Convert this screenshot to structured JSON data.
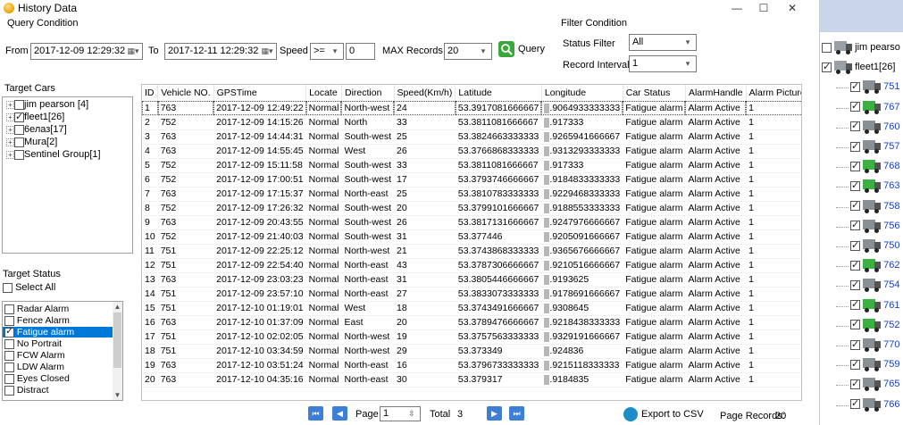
{
  "window": {
    "title": "History Data",
    "minimize": "—",
    "maximize": "☐",
    "close": "✕"
  },
  "query": {
    "group_title": "Query Condition",
    "from_label": "From",
    "from_value": "2017-12-09 12:29:32",
    "to_label": "To",
    "to_value": "2017-12-11 12:29:32",
    "speed_label": "Speed",
    "speed_op": ">=",
    "speed_value": "0",
    "max_records_label": "MAX Records",
    "max_records_value": "20",
    "query_button": "Query"
  },
  "filter": {
    "group_title": "Filter Condition",
    "status_filter_label": "Status Filter",
    "status_filter_value": "All",
    "record_interval_label": "Record Interval",
    "record_interval_value": "1"
  },
  "target_cars": {
    "title": "Target Cars",
    "items": [
      {
        "label": "jim pearson [4]",
        "checked": false
      },
      {
        "label": "fleet1[26]",
        "checked": true
      },
      {
        "label": "6елаз[17]",
        "checked": false
      },
      {
        "label": "Mura[2]",
        "checked": false
      },
      {
        "label": "Sentinel Group[1]",
        "checked": false
      }
    ]
  },
  "target_status": {
    "title": "Target Status",
    "select_all": "Select All",
    "items": [
      {
        "label": "Radar Alarm",
        "checked": false,
        "selected": false
      },
      {
        "label": "Fence Alarm",
        "checked": false,
        "selected": false
      },
      {
        "label": "Fatigue alarm",
        "checked": true,
        "selected": true
      },
      {
        "label": "No Portrait",
        "checked": false,
        "selected": false
      },
      {
        "label": "FCW Alarm",
        "checked": false,
        "selected": false
      },
      {
        "label": "LDW Alarm",
        "checked": false,
        "selected": false
      },
      {
        "label": "Eyes Closed",
        "checked": false,
        "selected": false
      },
      {
        "label": "Distract",
        "checked": false,
        "selected": false
      }
    ]
  },
  "table": {
    "columns": [
      "ID",
      "Vehicle NO.",
      "GPSTime",
      "Locate",
      "Direction",
      "Speed(Km/h)",
      "Latitude",
      "Longitude",
      "Car Status",
      "AlarmHandle",
      "Alarm Picture"
    ],
    "rows": [
      [
        "1",
        "763",
        "2017-12-09 12:49:22",
        "Normal",
        "North-west",
        "24",
        "53.3917081666667",
        ".9064933333333",
        "Fatigue alarm",
        "Alarm Active",
        "1"
      ],
      [
        "2",
        "752",
        "2017-12-09 14:15:26",
        "Normal",
        "North",
        "33",
        "53.3811081666667",
        ".917333",
        "Fatigue alarm",
        "Alarm Active",
        "1"
      ],
      [
        "3",
        "763",
        "2017-12-09 14:44:31",
        "Normal",
        "South-west",
        "25",
        "53.3824663333333",
        ".9265941666667",
        "Fatigue alarm",
        "Alarm Active",
        "1"
      ],
      [
        "4",
        "763",
        "2017-12-09 14:55:45",
        "Normal",
        "West",
        "26",
        "53.3766868333333",
        ".9313293333333",
        "Fatigue alarm",
        "Alarm Active",
        "1"
      ],
      [
        "5",
        "752",
        "2017-12-09 15:11:58",
        "Normal",
        "South-west",
        "33",
        "53.3811081666667",
        ".917333",
        "Fatigue alarm",
        "Alarm Active",
        "1"
      ],
      [
        "6",
        "752",
        "2017-12-09 17:00:51",
        "Normal",
        "South-west",
        "17",
        "53.3793746666667",
        ".9184833333333",
        "Fatigue alarm",
        "Alarm Active",
        "1"
      ],
      [
        "7",
        "763",
        "2017-12-09 17:15:37",
        "Normal",
        "North-east",
        "25",
        "53.3810783333333",
        ".9229468333333",
        "Fatigue alarm",
        "Alarm Active",
        "1"
      ],
      [
        "8",
        "752",
        "2017-12-09 17:26:32",
        "Normal",
        "South-west",
        "20",
        "53.3799101666667",
        ".9188553333333",
        "Fatigue alarm",
        "Alarm Active",
        "1"
      ],
      [
        "9",
        "763",
        "2017-12-09 20:43:55",
        "Normal",
        "South-west",
        "26",
        "53.3817131666667",
        ".9247976666667",
        "Fatigue alarm",
        "Alarm Active",
        "1"
      ],
      [
        "10",
        "752",
        "2017-12-09 21:40:03",
        "Normal",
        "South-west",
        "31",
        "53.377446",
        ".9205091666667",
        "Fatigue alarm",
        "Alarm Active",
        "1"
      ],
      [
        "11",
        "751",
        "2017-12-09 22:25:12",
        "Normal",
        "North-west",
        "21",
        "53.3743868333333",
        ".9365676666667",
        "Fatigue alarm",
        "Alarm Active",
        "1"
      ],
      [
        "12",
        "751",
        "2017-12-09 22:54:40",
        "Normal",
        "North-east",
        "43",
        "53.3787306666667",
        ".9210516666667",
        "Fatigue alarm",
        "Alarm Active",
        "1"
      ],
      [
        "13",
        "763",
        "2017-12-09 23:03:23",
        "Normal",
        "North-east",
        "31",
        "53.3805446666667",
        ".9193625",
        "Fatigue alarm",
        "Alarm Active",
        "1"
      ],
      [
        "14",
        "751",
        "2017-12-09 23:57:10",
        "Normal",
        "North-east",
        "27",
        "53.3833073333333",
        ".9178691666667",
        "Fatigue alarm",
        "Alarm Active",
        "1"
      ],
      [
        "15",
        "751",
        "2017-12-10 01:19:01",
        "Normal",
        "West",
        "18",
        "53.3743491666667",
        ".9308645",
        "Fatigue alarm",
        "Alarm Active",
        "1"
      ],
      [
        "16",
        "763",
        "2017-12-10 01:37:09",
        "Normal",
        "East",
        "20",
        "53.3789476666667",
        ".9218438333333",
        "Fatigue alarm",
        "Alarm Active",
        "1"
      ],
      [
        "17",
        "751",
        "2017-12-10 02:02:05",
        "Normal",
        "North-west",
        "19",
        "53.3757563333333",
        ".9329191666667",
        "Fatigue alarm",
        "Alarm Active",
        "1"
      ],
      [
        "18",
        "751",
        "2017-12-10 03:34:59",
        "Normal",
        "North-west",
        "29",
        "53.373349",
        ".924836",
        "Fatigue alarm",
        "Alarm Active",
        "1"
      ],
      [
        "19",
        "763",
        "2017-12-10 03:51:24",
        "Normal",
        "North-east",
        "16",
        "53.3796733333333",
        ".9215118333333",
        "Fatigue alarm",
        "Alarm Active",
        "1"
      ],
      [
        "20",
        "763",
        "2017-12-10 04:35:16",
        "Normal",
        "North-east",
        "30",
        "53.379317",
        ".9184835",
        "Fatigue alarm",
        "Alarm Active",
        "1"
      ]
    ]
  },
  "pager": {
    "page_label": "Page",
    "page_value": "1",
    "total_label": "Total",
    "total_value": "3",
    "export_label": "Export to CSV",
    "page_records_label": "Page Records:",
    "page_records_value": "20"
  },
  "right_tree": {
    "items": [
      {
        "label": "jim pearso",
        "level": 0,
        "checked": false,
        "color": "#9aa0a6"
      },
      {
        "label": "fleet1[26]",
        "level": 0,
        "checked": true,
        "color": "#9aa0a6"
      },
      {
        "label": "751",
        "level": 1,
        "checked": true,
        "color": "#8a8f94"
      },
      {
        "label": "767",
        "level": 1,
        "checked": true,
        "color": "#3cb043"
      },
      {
        "label": "760",
        "level": 1,
        "checked": true,
        "color": "#8a8f94"
      },
      {
        "label": "757",
        "level": 1,
        "checked": true,
        "color": "#8a8f94"
      },
      {
        "label": "768",
        "level": 1,
        "checked": true,
        "color": "#3cb043"
      },
      {
        "label": "763",
        "level": 1,
        "checked": true,
        "color": "#3cb043"
      },
      {
        "label": "758",
        "level": 1,
        "checked": true,
        "color": "#8a8f94"
      },
      {
        "label": "756",
        "level": 1,
        "checked": true,
        "color": "#8a8f94"
      },
      {
        "label": "750",
        "level": 1,
        "checked": true,
        "color": "#8a8f94"
      },
      {
        "label": "762",
        "level": 1,
        "checked": true,
        "color": "#3cb043"
      },
      {
        "label": "754",
        "level": 1,
        "checked": true,
        "color": "#8a8f94"
      },
      {
        "label": "761",
        "level": 1,
        "checked": true,
        "color": "#3cb043"
      },
      {
        "label": "752",
        "level": 1,
        "checked": true,
        "color": "#3cb043"
      },
      {
        "label": "770",
        "level": 1,
        "checked": true,
        "color": "#8a8f94"
      },
      {
        "label": "759",
        "level": 1,
        "checked": true,
        "color": "#8a8f94"
      },
      {
        "label": "765",
        "level": 1,
        "checked": true,
        "color": "#8a8f94"
      },
      {
        "label": "766",
        "level": 1,
        "checked": true,
        "color": "#8a8f94"
      }
    ]
  }
}
